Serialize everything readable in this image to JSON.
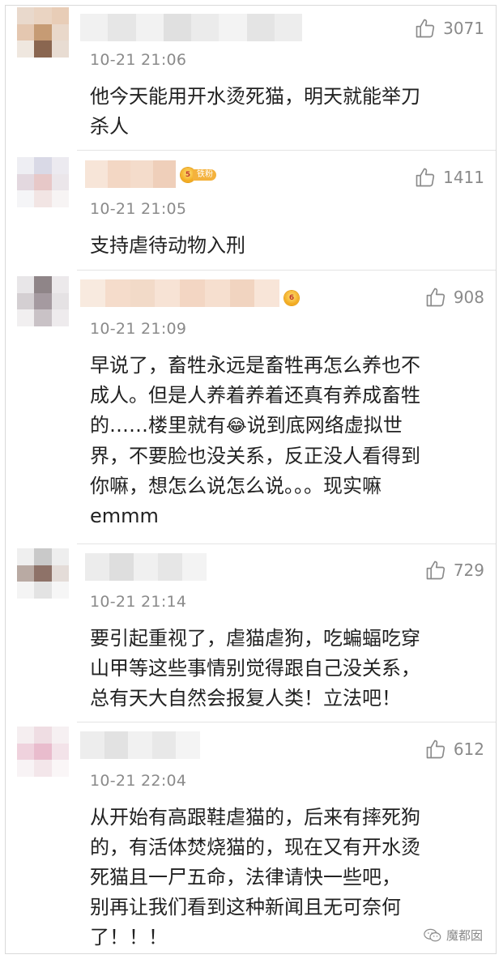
{
  "comments": [
    {
      "time": "10-21 21:06",
      "likes": "3071",
      "text": "他今天能用开水烫死猫，明天就能举刀\n杀人",
      "has_badge": false
    },
    {
      "time": "10-21 21:05",
      "likes": "1411",
      "text": "支持虐待动物入刑",
      "badge_label": "铁粉",
      "badge_level": "5"
    },
    {
      "time": "10-21 21:09",
      "likes": "908",
      "text_before_emoji": "早说了，畜牲永远是畜牲再怎么养也不\n成人。但是人养着养着还真有养成畜牲\n的……楼里就有",
      "emoji": "😂",
      "text_after_emoji": "说到底网络虚拟世\n界，不要脸也没关系，反正没人看得到\n你嘛，想怎么说怎么说。。。现实嘛\nemmm",
      "badge_level": "6"
    },
    {
      "time": "10-21 21:14",
      "likes": "729",
      "text": "要引起重视了，虐猫虐狗，吃蝙蝠吃穿\n山甲等这些事情别觉得跟自己没关系，\n总有天大自然会报复人类！立法吧！"
    },
    {
      "time": "10-21 22:04",
      "likes": "612",
      "text": "从开始有高跟鞋虐猫的，后来有摔死狗\n的，有活体焚烧猫的，现在又有开水烫\n死猫且一尸五命，法律请快一些吧，\n别再让我们看到这种新闻且无可奈何\n了！！！"
    }
  ],
  "watermark": {
    "label": "魔都囡"
  },
  "colors": {
    "text": "#222222",
    "meta": "#8a8a8a",
    "divider": "#e4e4e4",
    "badge": "#f4b23d"
  },
  "icons": {
    "like": "thumbs-up-icon",
    "badge": "crown-icon",
    "watermark": "wechat-icon"
  }
}
